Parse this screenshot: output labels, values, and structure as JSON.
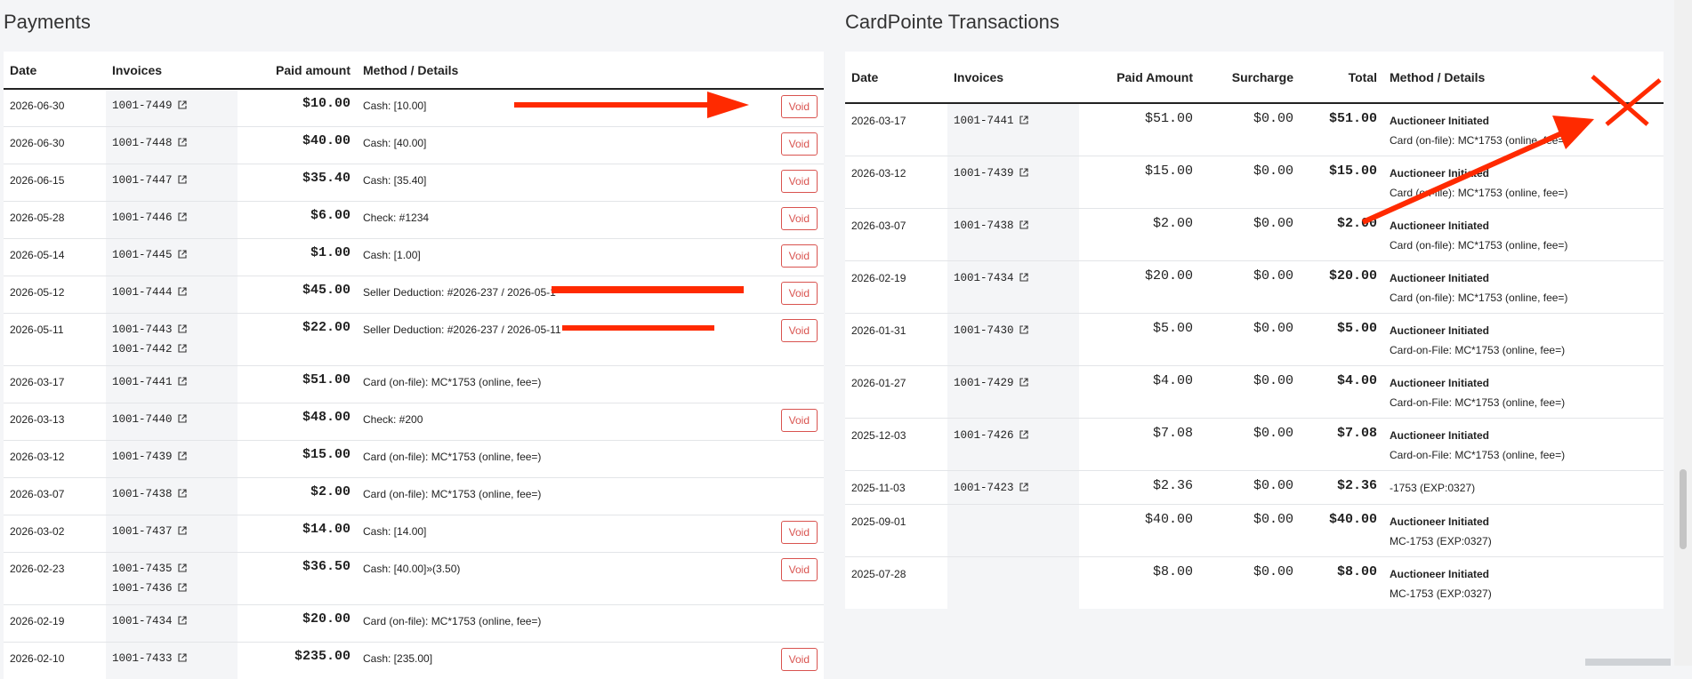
{
  "payments": {
    "title": "Payments",
    "columns": {
      "date": "Date",
      "invoices": "Invoices",
      "paid": "Paid amount",
      "method": "Method / Details"
    },
    "void_label": "Void",
    "rows": [
      {
        "date": "2026-06-30",
        "invoices": [
          "1001-7449"
        ],
        "paid": "$10.00",
        "method": "Cash: [10.00]",
        "void": true
      },
      {
        "date": "2026-06-30",
        "invoices": [
          "1001-7448"
        ],
        "paid": "$40.00",
        "method": "Cash: [40.00]",
        "void": true
      },
      {
        "date": "2026-06-15",
        "invoices": [
          "1001-7447"
        ],
        "paid": "$35.40",
        "method": "Cash: [35.40]",
        "void": true
      },
      {
        "date": "2026-05-28",
        "invoices": [
          "1001-7446"
        ],
        "paid": "$6.00",
        "method": "Check: #1234",
        "void": true
      },
      {
        "date": "2026-05-14",
        "invoices": [
          "1001-7445"
        ],
        "paid": "$1.00",
        "method": "Cash: [1.00]",
        "void": true
      },
      {
        "date": "2026-05-12",
        "invoices": [
          "1001-7444"
        ],
        "paid": "$45.00",
        "method": "Seller Deduction: #2026-237 / 2026-05-1",
        "void": true
      },
      {
        "date": "2026-05-11",
        "invoices": [
          "1001-7443",
          "1001-7442"
        ],
        "paid": "$22.00",
        "method": "Seller Deduction: #2026-237 / 2026-05-11",
        "void": true
      },
      {
        "date": "2026-03-17",
        "invoices": [
          "1001-7441"
        ],
        "paid": "$51.00",
        "method": "Card (on-file): MC*1753 (online, fee=)",
        "void": false
      },
      {
        "date": "2026-03-13",
        "invoices": [
          "1001-7440"
        ],
        "paid": "$48.00",
        "method": "Check: #200",
        "void": true
      },
      {
        "date": "2026-03-12",
        "invoices": [
          "1001-7439"
        ],
        "paid": "$15.00",
        "method": "Card (on-file): MC*1753 (online, fee=)",
        "void": false
      },
      {
        "date": "2026-03-07",
        "invoices": [
          "1001-7438"
        ],
        "paid": "$2.00",
        "method": "Card (on-file): MC*1753 (online, fee=)",
        "void": false
      },
      {
        "date": "2026-03-02",
        "invoices": [
          "1001-7437"
        ],
        "paid": "$14.00",
        "method": "Cash: [14.00]",
        "void": true
      },
      {
        "date": "2026-02-23",
        "invoices": [
          "1001-7435",
          "1001-7436"
        ],
        "paid": "$36.50",
        "method": "Cash: [40.00]»(3.50)",
        "void": true
      },
      {
        "date": "2026-02-19",
        "invoices": [
          "1001-7434"
        ],
        "paid": "$20.00",
        "method": "Card (on-file): MC*1753 (online, fee=)",
        "void": false
      },
      {
        "date": "2026-02-10",
        "invoices": [
          "1001-7433"
        ],
        "paid": "$235.00",
        "method": "Cash: [235.00]",
        "void": true
      }
    ]
  },
  "cardpointe": {
    "title": "CardPointe Transactions",
    "columns": {
      "date": "Date",
      "invoices": "Invoices",
      "paid": "Paid Amount",
      "surcharge": "Surcharge",
      "total": "Total",
      "method": "Method / Details"
    },
    "rows": [
      {
        "date": "2026-03-17",
        "invoices": [
          "1001-7441"
        ],
        "paid": "$51.00",
        "surcharge": "$0.00",
        "total": "$51.00",
        "method_title": "Auctioneer Initiated",
        "method_detail": "Card (on-file): MC*1753 (online, fee=)"
      },
      {
        "date": "2026-03-12",
        "invoices": [
          "1001-7439"
        ],
        "paid": "$15.00",
        "surcharge": "$0.00",
        "total": "$15.00",
        "method_title": "Auctioneer Initiated",
        "method_detail": "Card (on-file): MC*1753 (online, fee=)"
      },
      {
        "date": "2026-03-07",
        "invoices": [
          "1001-7438"
        ],
        "paid": "$2.00",
        "surcharge": "$0.00",
        "total": "$2.00",
        "method_title": "Auctioneer Initiated",
        "method_detail": "Card (on-file): MC*1753 (online, fee=)"
      },
      {
        "date": "2026-02-19",
        "invoices": [
          "1001-7434"
        ],
        "paid": "$20.00",
        "surcharge": "$0.00",
        "total": "$20.00",
        "method_title": "Auctioneer Initiated",
        "method_detail": "Card (on-file): MC*1753 (online, fee=)"
      },
      {
        "date": "2026-01-31",
        "invoices": [
          "1001-7430"
        ],
        "paid": "$5.00",
        "surcharge": "$0.00",
        "total": "$5.00",
        "method_title": "Auctioneer Initiated",
        "method_detail": "Card-on-File: MC*1753 (online, fee=)"
      },
      {
        "date": "2026-01-27",
        "invoices": [
          "1001-7429"
        ],
        "paid": "$4.00",
        "surcharge": "$0.00",
        "total": "$4.00",
        "method_title": "Auctioneer Initiated",
        "method_detail": "Card-on-File: MC*1753 (online, fee=)"
      },
      {
        "date": "2025-12-03",
        "invoices": [
          "1001-7426"
        ],
        "paid": "$7.08",
        "surcharge": "$0.00",
        "total": "$7.08",
        "method_title": "Auctioneer Initiated",
        "method_detail": "Card-on-File: MC*1753 (online, fee=)"
      },
      {
        "date": "2025-11-03",
        "invoices": [
          "1001-7423"
        ],
        "paid": "$2.36",
        "surcharge": "$0.00",
        "total": "$2.36",
        "method_title": "",
        "method_detail": "-1753 (EXP:0327)"
      },
      {
        "date": "2025-09-01",
        "invoices": [],
        "paid": "$40.00",
        "surcharge": "$0.00",
        "total": "$40.00",
        "method_title": "Auctioneer Initiated",
        "method_detail": "MC-1753 (EXP:0327)"
      },
      {
        "date": "2025-07-28",
        "invoices": [],
        "paid": "$8.00",
        "surcharge": "$0.00",
        "total": "$8.00",
        "method_title": "Auctioneer Initiated",
        "method_detail": "MC-1753 (EXP:0327)"
      }
    ]
  },
  "colors": {
    "void": "#d9534f",
    "annotation": "#ff2a00"
  },
  "icons": {
    "invoice_link": "external-link-icon"
  }
}
